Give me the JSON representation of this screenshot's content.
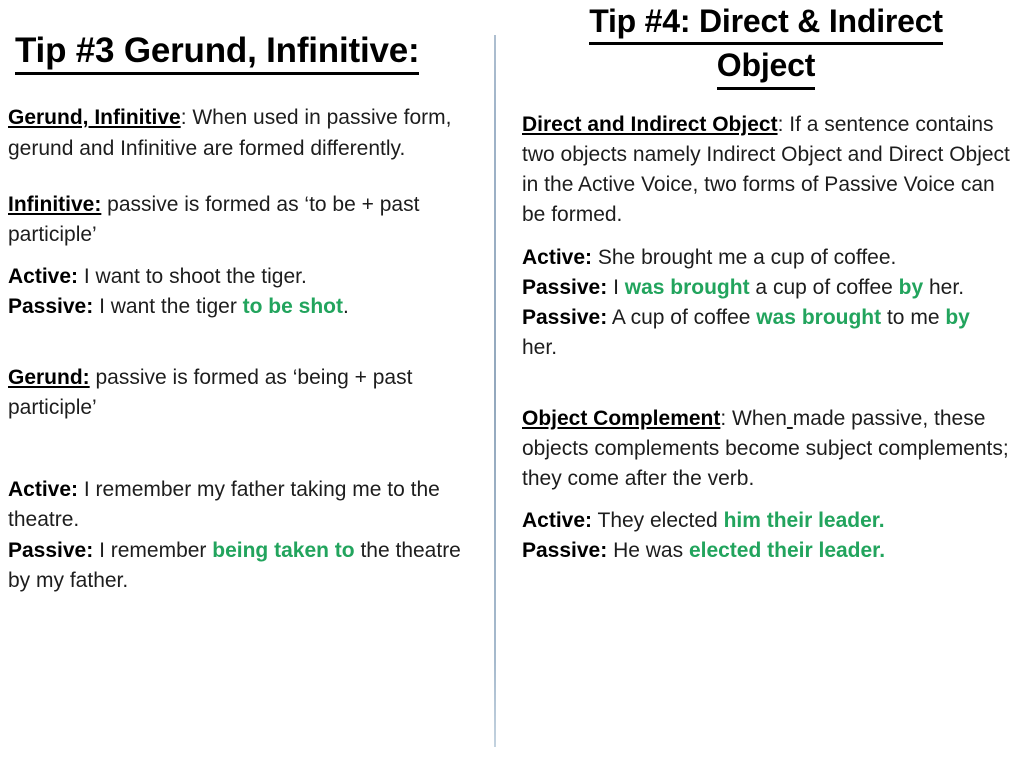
{
  "slide": {
    "background_color": "#ffffff",
    "accent_color": "#22a45d",
    "divider_color": "#93a8bd"
  },
  "left_column": {
    "title": "Tip #3 Gerund, Infinitive:",
    "blocks": {
      "intro": {
        "label": "Gerund, Infinitive",
        "label_suffix": ":",
        "text": " When used in passive form, gerund and Infinitive are formed differently."
      },
      "infinitive_rule": {
        "label": "Infinitive:",
        "text": " passive is formed as ‘to be + past participle’"
      },
      "infinitive_active": {
        "label": "Active:",
        "text": " I want to shoot the tiger."
      },
      "infinitive_passive": {
        "label": "Passive:",
        "text_before": " I want the tiger ",
        "highlight": "to be shot",
        "text_after": "."
      },
      "gerund_rule": {
        "label": "Gerund:",
        "text": " passive is formed as ‘being + past participle’"
      },
      "gerund_active": {
        "label": "Active:",
        "text": " I remember my father taking me to the theatre."
      },
      "gerund_passive": {
        "label": "Passive:",
        "text_before": " I remember ",
        "highlight": "being taken to",
        "text_after": " the theatre by my father."
      }
    }
  },
  "right_column": {
    "title_line1": "Tip #4: Direct & Indirect",
    "title_line2": "Object",
    "blocks": {
      "intro": {
        "label": "Direct and Indirect Object",
        "label_suffix": ":",
        "text": " If a sentence contains two objects namely Indirect Object and Direct Object in the Active Voice, two forms of Passive Voice can be formed."
      },
      "coffee_active": {
        "label": "Active:",
        "text": " She brought me a cup of coffee."
      },
      "coffee_passive_1": {
        "label": "Passive:",
        "text_1": " I ",
        "highlight_1": "was brought",
        "text_2": " a cup of coffee ",
        "highlight_2": "by",
        "text_3": " her."
      },
      "coffee_passive_2": {
        "label": "Passive:",
        "text_1": " A cup of coffee ",
        "highlight_1": "was brought",
        "text_2": " to me ",
        "highlight_2": "by",
        "text_3": " her."
      },
      "object_complement": {
        "label": "Object Complement",
        "label_suffix": ":",
        "text_before": " When",
        "underlined_space": " ",
        "text_after": "made passive, these objects complements become subject complements; they come after the verb."
      },
      "leader_active": {
        "label": "Active:",
        "text_before": " They elected ",
        "highlight": "him their leader."
      },
      "leader_passive": {
        "label": "Passive:",
        "text_before": " He was ",
        "highlight": "elected their leader."
      }
    }
  }
}
